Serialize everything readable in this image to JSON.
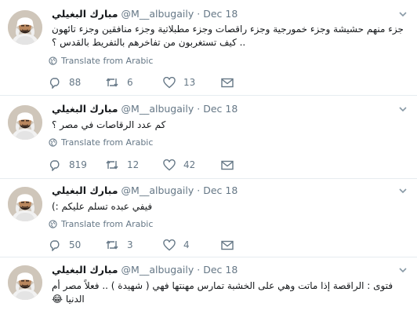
{
  "tweets": [
    {
      "name": "مبارك البغيلي",
      "handle": "@M__albugaily",
      "separator": "·",
      "date": "Dec 18",
      "text": "جزء منهم حشيشة وجزء خمورجية وجزء راقصات وجزء مطبلاتية وجزء منافقين وجزء تائهون .. كيف تستغربون من تفاخرهم بالتفريط بالقدس ؟",
      "translate": "Translate from Arabic",
      "replies": "88",
      "retweets": "6",
      "likes": "13"
    },
    {
      "name": "مبارك البغيلي",
      "handle": "@M__albugaily",
      "separator": "·",
      "date": "Dec 18",
      "text": "كم عدد الرقاصات في مصر ؟",
      "translate": "Translate from Arabic",
      "replies": "819",
      "retweets": "12",
      "likes": "42"
    },
    {
      "name": "مبارك البغيلي",
      "handle": "@M__albugaily",
      "separator": "·",
      "date": "Dec 18",
      "text": "فيفي عبده تسلم عليكم :)",
      "translate": "Translate from Arabic",
      "replies": "50",
      "retweets": "3",
      "likes": "4"
    },
    {
      "name": "مبارك البغيلي",
      "handle": "@M__albugaily",
      "separator": "·",
      "date": "Dec 18",
      "text": "فتوى : الراقصة إذا ماتت وهي على الخشبة تمارس مهنتها فهي ( شهيدة ) .. فعلاً مصر أم الدنيا 😂"
    }
  ],
  "icons": {
    "reply": "reply-icon",
    "retweet": "retweet-icon",
    "like": "heart-icon",
    "message": "envelope-icon",
    "translate": "globe-icon",
    "menu": "chevron-down-icon"
  },
  "colors": {
    "text": "#14171a",
    "muted": "#657786",
    "divider": "#e6ecf0"
  }
}
